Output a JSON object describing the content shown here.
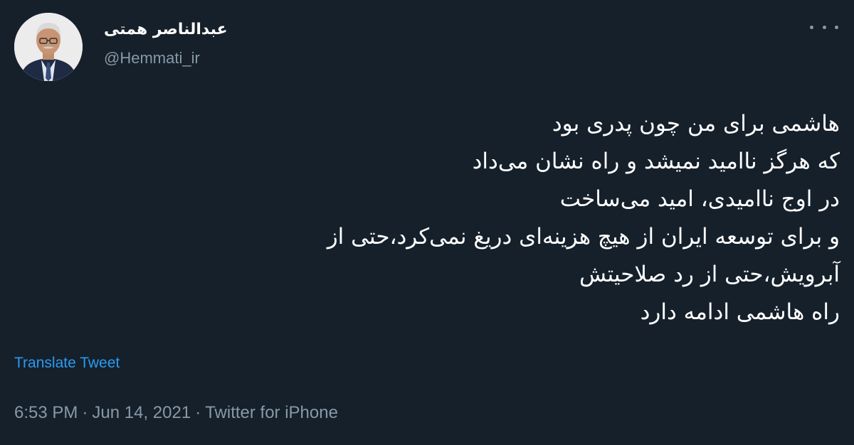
{
  "author": {
    "display_name": "عبدالناصر همتی",
    "handle": "@Hemmati_ir"
  },
  "tweet": {
    "lines": [
      "هاشمی برای من چون پدری بود",
      "که هرگز ناامید نمیشد و راه نشان می‌داد",
      "در اوج ناامیدی، امید می‌ساخت",
      "و برای توسعه ایران از هیچ هزینه‌ای دریغ نمی‌کرد،حتی از",
      "آبرویش،حتی از رد صلاحیتش",
      "راه هاشمی ادامه دارد"
    ],
    "translate_label": "Translate Tweet"
  },
  "meta": {
    "time": "6:53 PM",
    "separator": "·",
    "date": "Jun 14, 2021",
    "source": "Twitter for iPhone"
  },
  "icons": {
    "more": "more-horizontal-icon"
  },
  "colors": {
    "background": "#15202b",
    "text": "#ffffff",
    "secondary": "#8899a6",
    "link": "#2b9bf0"
  }
}
